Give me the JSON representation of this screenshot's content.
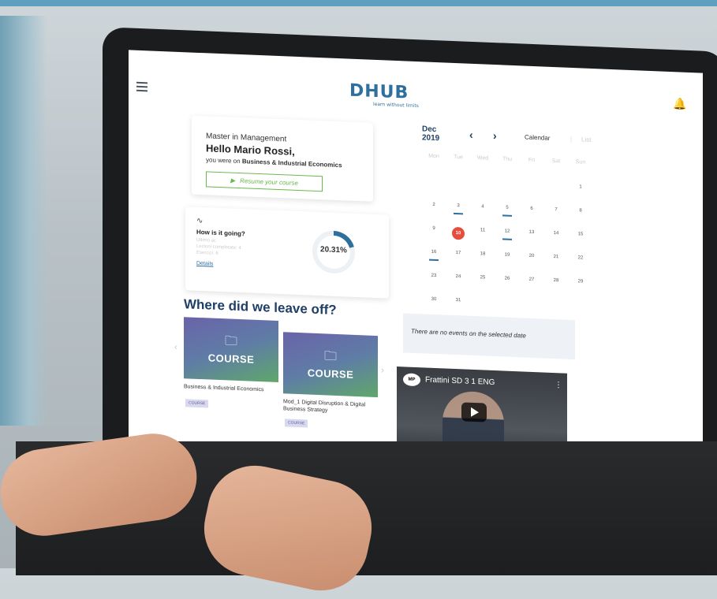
{
  "app": {
    "logo": "DHUB",
    "tagline": "learn without limits"
  },
  "course_card": {
    "program": "Master in Management",
    "greeting": "Hello Mario Rossi,",
    "prefix": "you were on",
    "course": "Business & Industrial Economics",
    "resume_label": "Resume your course"
  },
  "progress_card": {
    "question": "How is it going?",
    "faint_line1": "Ultimo ac",
    "faint_line2": "Lezioni completate: 4",
    "faint_line3": "Esercizi: 6",
    "details_label": "Details",
    "percent": "20.31%",
    "progress_value": 0.2031
  },
  "where": {
    "heading": "Where did we leave off?",
    "courses": [
      {
        "tile_label": "COURSE",
        "title": "Business & Industrial Economics",
        "badge": "COURSE"
      },
      {
        "tile_label": "COURSE",
        "title": "Mod_1 Digital Disruption & Digital Business Strategy",
        "badge": "COURSE"
      }
    ]
  },
  "calendar": {
    "month": "Dec",
    "year": "2019",
    "tab_calendar": "Calendar",
    "tab_list": "List",
    "weekdays": [
      "Mon",
      "Tue",
      "Wed",
      "Thu",
      "Fri",
      "Sat",
      "Sun"
    ],
    "days": [
      "1",
      "2",
      "3",
      "4",
      "5",
      "6",
      "7",
      "8",
      "9",
      "10",
      "11",
      "12",
      "13",
      "14",
      "15",
      "16",
      "17",
      "18",
      "19",
      "20",
      "21",
      "22",
      "23",
      "24",
      "25",
      "26",
      "27",
      "28",
      "29",
      "30",
      "31"
    ],
    "today": "10",
    "marked_days": [
      "3",
      "5",
      "12",
      "16"
    ],
    "no_events": "There are no events on the selected date"
  },
  "video": {
    "channel_logo": "MP",
    "title": "Frattini SD 3 1 ENG"
  },
  "colors": {
    "accent": "#2e6f9e",
    "green": "#69b84d",
    "today": "#e74c3c"
  }
}
